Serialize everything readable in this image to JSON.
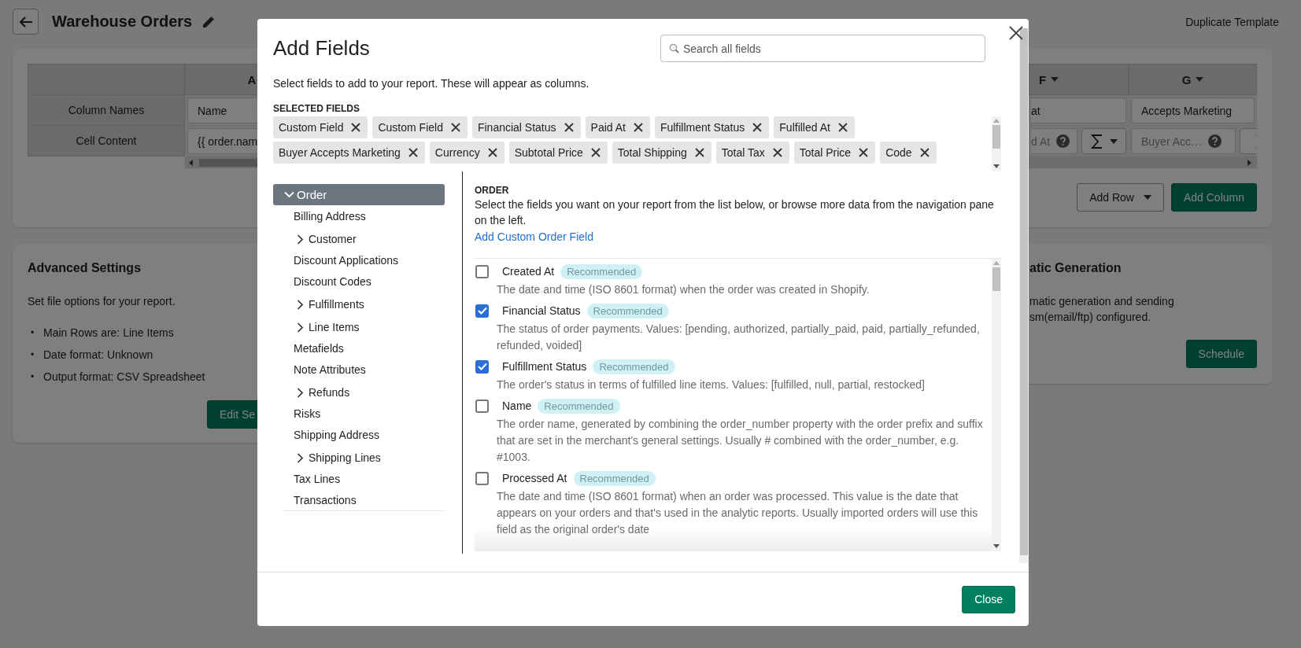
{
  "page": {
    "title": "Warehouse Orders",
    "header_action": "Duplicate Template"
  },
  "template_table": {
    "row_labels": [
      "Column Names",
      "Cell Content"
    ],
    "columns": [
      {
        "header": "A",
        "column_name": "Name",
        "cell_content": "{{ order.nam",
        "kind": "value"
      },
      {
        "header": "F",
        "column_name": "at",
        "cell_content": "d At",
        "kind": "placeholder"
      },
      {
        "header": "G",
        "column_name": "Accepts Marketing",
        "cell_content": "Buyer Acc…",
        "kind": "placeholder"
      }
    ]
  },
  "template_actions": [
    {
      "label": "Add Row",
      "kind": "dropdown"
    },
    {
      "label": "Add Column",
      "kind": "primary"
    }
  ],
  "advanced_settings": {
    "title": "Advanced Settings",
    "description": "Set file options for your report.",
    "items": [
      {
        "marker": "•",
        "text": "Main Rows are: Line Items"
      },
      {
        "marker": "•",
        "text": "Date format: Unknown"
      },
      {
        "marker": "•",
        "text": "Output format: CSV Spreadsheet"
      }
    ],
    "button": "Edit Se"
  },
  "automatic_generation": {
    "title": "atic Generation",
    "description_lines": [
      "matic generation and sending",
      "sm(email/ftp) configured."
    ],
    "button": "Schedule"
  },
  "dialog": {
    "title": "Add Fields",
    "search": {
      "placeholder": "Search all fields"
    },
    "description": "Select fields to add to your report. These will appear as columns.",
    "selected_fields": {
      "label": "SELECTED FIELDS",
      "chips": [
        "Custom Field",
        "Custom Field",
        "Financial Status",
        "Paid At",
        "Fulfillment Status",
        "Fulfilled At",
        "Buyer Accepts Marketing",
        "Currency",
        "Subtotal Price",
        "Total Shipping",
        "Total Tax",
        "Total Price",
        "Code"
      ]
    },
    "navigation": [
      {
        "label": "Order",
        "selected": true,
        "expanded": true,
        "children": [
          {
            "label": "Billing Address",
            "kind": "leaf"
          },
          {
            "label": "Customer",
            "kind": "group"
          },
          {
            "label": "Discount Applications",
            "kind": "leaf"
          },
          {
            "label": "Discount Codes",
            "kind": "leaf"
          },
          {
            "label": "Fulfillments",
            "kind": "group"
          },
          {
            "label": "Line Items",
            "kind": "group"
          },
          {
            "label": "Metafields",
            "kind": "leaf"
          },
          {
            "label": "Note Attributes",
            "kind": "leaf"
          },
          {
            "label": "Refunds",
            "kind": "group"
          },
          {
            "label": "Risks",
            "kind": "leaf"
          },
          {
            "label": "Shipping Address",
            "kind": "leaf"
          },
          {
            "label": "Shipping Lines",
            "kind": "group"
          },
          {
            "label": "Tax Lines",
            "kind": "leaf"
          },
          {
            "label": "Transactions",
            "kind": "leaf"
          }
        ]
      }
    ],
    "section": {
      "title": "ORDER",
      "description": "Select the fields you want on your report from the list below, or browse more data from the navigation pane on the left.",
      "link": "Add Custom Order Field",
      "fields": [
        {
          "name": "Created At",
          "checked": false,
          "badge": "Recommended",
          "description": "The date and time (ISO 8601 format) when the order was created in Shopify."
        },
        {
          "name": "Financial Status",
          "checked": true,
          "badge": "Recommended",
          "description": "The status of order payments. Values: [pending, authorized, partially_paid, paid, partially_refunded, refunded, voided]"
        },
        {
          "name": "Fulfillment Status",
          "checked": true,
          "badge": "Recommended",
          "description": "The order's status in terms of fulfilled line items. Values: [fulfilled, null, partial, restocked]"
        },
        {
          "name": "Name",
          "checked": false,
          "badge": "Recommended",
          "description": "The order name, generated by combining the order_number property with the order prefix and suffix that are set in the merchant's general settings. Usually # combined with the order_number, e.g. #1003."
        },
        {
          "name": "Processed At",
          "checked": false,
          "badge": "Recommended",
          "description": "The date and time (ISO 8601 format) when an order was processed. This value is the date that appears on your orders and that's used in the analytic reports. Usually imported orders will use this field as the original order's date"
        }
      ]
    },
    "close_button": "Close"
  }
}
